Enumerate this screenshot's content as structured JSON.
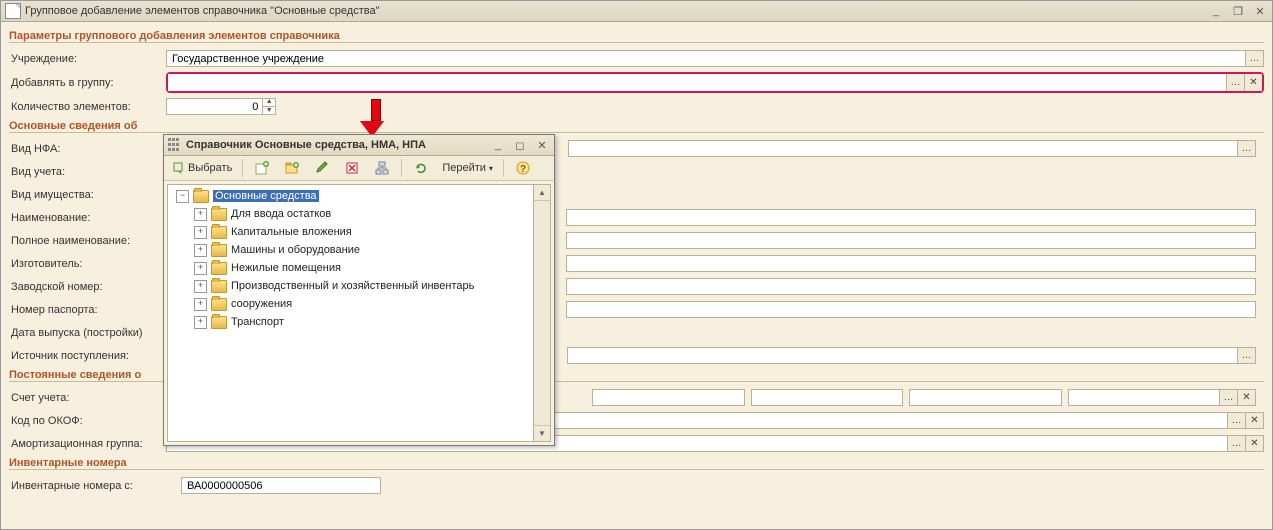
{
  "window": {
    "title": "Групповое добавление элементов справочника \"Основные средства\""
  },
  "sections": {
    "params": "Параметры группового добавления элементов справочника",
    "basic": "Основные сведения об",
    "perm": "Постоянные сведения о",
    "inv": "Инвентарные номера"
  },
  "labels": {
    "org": "Учреждение:",
    "group": "Добавлять в группу:",
    "count": "Количество элементов:",
    "nfa": "Вид НФА:",
    "acc": "Вид учета:",
    "prop": "Вид имущества:",
    "name": "Наименование:",
    "fullname": "Полное наименование:",
    "maker": "Изготовитель:",
    "serial": "Заводской номер:",
    "passport": "Номер паспорта:",
    "date": "Дата выпуска (постройки)",
    "source": "Источник поступления:",
    "account": "Счет учета:",
    "okof": "Код по ОКОФ:",
    "amort": "Амортизационная группа:",
    "invfrom": "Инвентарные номера с:"
  },
  "values": {
    "org": "Государственное учреждение",
    "group": "",
    "count": "0",
    "invfrom": "ВА0000000506"
  },
  "popup": {
    "title": "Справочник Основные средства, НМА, НПА",
    "select": "Выбрать",
    "goto": "Перейти",
    "tree": {
      "root": "Основные средства",
      "items": [
        "Для ввода остатков",
        "Капитальные вложения",
        "Машины и оборудование",
        "Нежилые помещения",
        "Производственный и хозяйственный инвентарь",
        "сооружения",
        "Транспорт"
      ]
    }
  }
}
